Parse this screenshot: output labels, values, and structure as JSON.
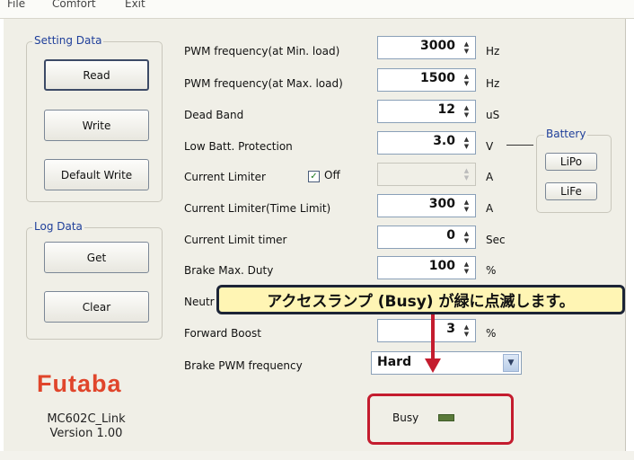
{
  "menu": {
    "file": "File",
    "comfort": "Comfort",
    "exit": "Exit"
  },
  "setting_group": {
    "title": "Setting Data",
    "read": "Read",
    "write": "Write",
    "default_write": "Default Write"
  },
  "log_group": {
    "title": "Log Data",
    "get": "Get",
    "clear": "Clear"
  },
  "params": [
    {
      "label": "PWM frequency(at Min. load)",
      "value": "3000",
      "unit": "Hz"
    },
    {
      "label": "PWM frequency(at Max. load)",
      "value": "1500",
      "unit": "Hz"
    },
    {
      "label": "Dead Band",
      "value": "12",
      "unit": "uS"
    },
    {
      "label": "Low Batt. Protection",
      "value": "3.0",
      "unit": "V"
    },
    {
      "label": "Current Limiter",
      "value": "",
      "unit": "A"
    },
    {
      "label": "Current Limiter(Time Limit)",
      "value": "300",
      "unit": "A"
    },
    {
      "label": "Current Limit timer",
      "value": "0",
      "unit": "Sec"
    },
    {
      "label": "Brake Max. Duty",
      "value": "100",
      "unit": "%"
    },
    {
      "label": "Neutr",
      "value": "",
      "unit": ""
    },
    {
      "label": "Forward Boost",
      "value": "3",
      "unit": "%"
    },
    {
      "label": "Brake PWM frequency",
      "value": "Hard",
      "unit": ""
    }
  ],
  "current_limiter_off": {
    "label": "Off",
    "checked": true
  },
  "battery": {
    "title": "Battery",
    "lipo": "LiPo",
    "life": "LiFe"
  },
  "brand": {
    "logo": "Futaba",
    "app": "MC602C_Link",
    "version": "Version 1.00"
  },
  "busy": {
    "label": "Busy",
    "led_color": "#5a7a3a"
  },
  "annotation": {
    "text": "アクセスランプ (Busy) が緑に点滅します。",
    "highlight_color": "#c41c2e",
    "fill_color": "#fff5b4"
  }
}
